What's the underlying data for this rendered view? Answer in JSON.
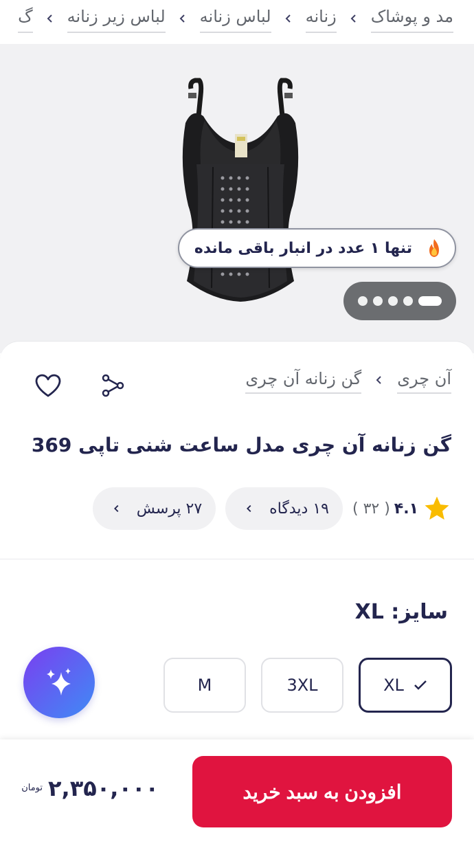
{
  "breadcrumb": {
    "items": [
      "مد و پوشاک",
      "زنانه",
      "لباس زنانه",
      "لباس زیر زنانه",
      "گ"
    ]
  },
  "gallery": {
    "stock_text": "تنها ۱ عدد در انبار باقی مانده",
    "dots_count": 5,
    "active_dot": 1
  },
  "brand": {
    "brand_name": "آن چری",
    "category": "گن زنانه آن چری"
  },
  "product": {
    "title": "گن زنانه آن چری مدل ساعت شنی تاپی 369",
    "rating": "۴.۱",
    "rating_count": "( ۳۲ )",
    "reviews_label": "۱۹ دیدگاه",
    "questions_label": "۲۷ پرسش"
  },
  "size": {
    "label": "سایز: XL",
    "options": [
      "XL",
      "3XL",
      "M"
    ],
    "selected": "XL"
  },
  "footer": {
    "add_to_cart": "افزودن به سبد خرید",
    "price": "۲,۳۵۰,۰۰۰",
    "currency": "تومان"
  },
  "colors": {
    "primary": "#e0143f",
    "text": "#23254e",
    "muted": "#62666d",
    "star": "#f9bc00"
  }
}
